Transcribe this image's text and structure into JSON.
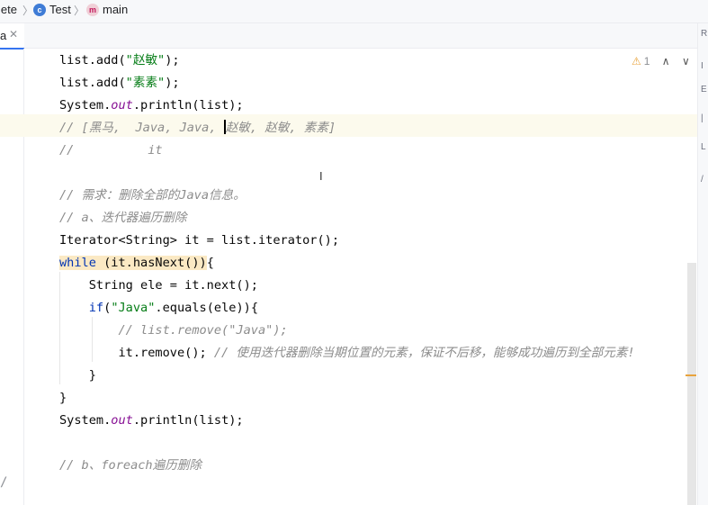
{
  "breadcrumb": {
    "items": [
      {
        "label": "lete",
        "icon": null
      },
      {
        "label": "Test",
        "icon": "class-icon"
      },
      {
        "label": "main",
        "icon": "method-icon"
      }
    ]
  },
  "tabs": {
    "active_label": "a",
    "close_glyph": "✕"
  },
  "right_toolbar": [
    "R",
    "I",
    "E",
    "|",
    "L",
    "/"
  ],
  "inspection": {
    "warning_icon": "⚠",
    "count": "1",
    "up": "∧",
    "down": "∨"
  },
  "left_gutter_marker": "/",
  "editor_lines": [
    [
      {
        "t": "list.add(",
        "c": ""
      },
      {
        "t": "\"赵敏\"",
        "c": "str"
      },
      {
        "t": ");",
        "c": ""
      }
    ],
    [
      {
        "t": "list.add(",
        "c": ""
      },
      {
        "t": "\"素素\"",
        "c": "str"
      },
      {
        "t": ");",
        "c": ""
      }
    ],
    [
      {
        "t": "System.",
        "c": ""
      },
      {
        "t": "out",
        "c": "fld"
      },
      {
        "t": ".println(list);",
        "c": ""
      }
    ],
    [
      {
        "t": "// [黑马,  Java, Java, ",
        "c": "cmt"
      },
      {
        "t": "",
        "c": "caret"
      },
      {
        "t": "赵敏, 赵敏, 素素]",
        "c": "cmt"
      }
    ],
    [
      {
        "t": "//          it",
        "c": "cmt"
      }
    ],
    [],
    [
      {
        "t": "// 需求：删除全部的Java信息。",
        "c": "cmt"
      }
    ],
    [
      {
        "t": "// a、迭代器遍历删除",
        "c": "cmt"
      }
    ],
    [
      {
        "t": "Iterator<String> it = list.iterator();",
        "c": ""
      }
    ],
    [
      {
        "t": "while",
        "c": "kw hlw"
      },
      {
        "t": " (it.hasNext())",
        "c": "hlw"
      },
      {
        "t": "{",
        "c": ""
      }
    ],
    [
      {
        "t": "    String ele = it.next();",
        "c": ""
      }
    ],
    [
      {
        "t": "    ",
        "c": ""
      },
      {
        "t": "if",
        "c": "kw"
      },
      {
        "t": "(",
        "c": ""
      },
      {
        "t": "\"Java\"",
        "c": "str"
      },
      {
        "t": ".equals(ele)){",
        "c": ""
      }
    ],
    [
      {
        "t": "        // list.remove(\"Java\");",
        "c": "cmt"
      }
    ],
    [
      {
        "t": "        it.remove(); ",
        "c": ""
      },
      {
        "t": "// 使用迭代器删除当期位置的元素，保证不后移，能够成功遍历到全部元素!",
        "c": "cmt"
      }
    ],
    [
      {
        "t": "    }",
        "c": ""
      }
    ],
    [
      {
        "t": "}",
        "c": ""
      }
    ],
    [
      {
        "t": "System.",
        "c": ""
      },
      {
        "t": "out",
        "c": "fld"
      },
      {
        "t": ".println(list);",
        "c": ""
      }
    ],
    [],
    [
      {
        "t": "// b、foreach遍历删除",
        "c": "cmt"
      }
    ]
  ]
}
